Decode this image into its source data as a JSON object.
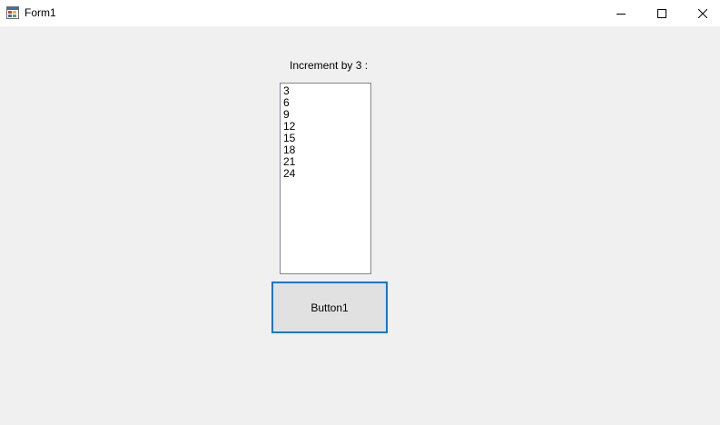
{
  "window": {
    "title": "Form1",
    "app_icon": "winforms-app-icon",
    "controls": {
      "minimize_icon": "minimize-icon",
      "maximize_icon": "maximize-icon",
      "close_icon": "close-icon"
    }
  },
  "form": {
    "label": "Increment by 3 :",
    "list_items": [
      "3",
      "6",
      "9",
      "12",
      "15",
      "18",
      "21",
      "24"
    ],
    "button_label": "Button1"
  },
  "colors": {
    "form_background": "#f0f0f0",
    "titlebar_background": "#ffffff",
    "button_focus_border": "#0078d7",
    "button_background": "#e1e1e1",
    "listbox_border": "#828790"
  }
}
